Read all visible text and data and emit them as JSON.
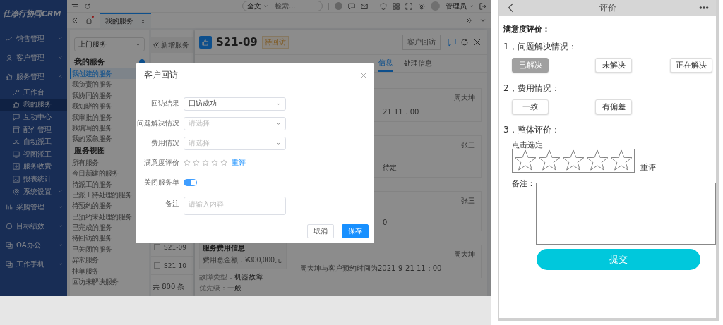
{
  "sidebar": {
    "logo": "仕净行协同CRM",
    "items": [
      {
        "label": "销售管理",
        "selected": false,
        "expanded": false
      },
      {
        "label": "客户管理",
        "selected": false,
        "expanded": false
      },
      {
        "label": "服务管理",
        "selected": false,
        "expanded": true,
        "children": [
          {
            "label": "工作台",
            "selected": false
          },
          {
            "label": "我的服务",
            "selected": true
          },
          {
            "label": "互动中心",
            "selected": false
          },
          {
            "label": "配件管理",
            "selected": false
          },
          {
            "label": "自动派工",
            "selected": false
          },
          {
            "label": "视图派工",
            "selected": false
          },
          {
            "label": "服务收费",
            "selected": false
          },
          {
            "label": "报表统计",
            "selected": false
          },
          {
            "label": "系统设置",
            "selected": false,
            "expanded": false
          }
        ]
      },
      {
        "label": "采购管理",
        "selected": false,
        "expanded": false
      },
      {
        "label": "目标绩效",
        "selected": false,
        "expanded": false
      },
      {
        "label": "OA办公",
        "selected": false,
        "expanded": false
      },
      {
        "label": "工作手机",
        "selected": false,
        "expanded": false
      }
    ]
  },
  "topbar": {
    "search_scope": "全文",
    "search_placeholder": "检索...",
    "user": "管理员"
  },
  "tabs": {
    "home_dot": true,
    "items": [
      {
        "label": "我的服务",
        "selected": true
      }
    ]
  },
  "service_select": {
    "value": "上门服务"
  },
  "menu_sections": [
    {
      "title": "我的服务",
      "items": [
        {
          "label": "我创建的服务",
          "selected": true
        },
        {
          "label": "我负责的服务",
          "selected": false
        },
        {
          "label": "我协同的服务",
          "selected": false
        },
        {
          "label": "我知晓的服务",
          "selected": false
        },
        {
          "label": "我审批的服务",
          "selected": false
        },
        {
          "label": "我填写的服务",
          "selected": false
        },
        {
          "label": "我的紧急服务",
          "selected": false
        }
      ]
    },
    {
      "title": "服务视图",
      "items": [
        {
          "label": "所有服务",
          "selected": false
        },
        {
          "label": "今日新建的服务",
          "selected": false
        },
        {
          "label": "待派工的服务",
          "selected": false
        },
        {
          "label": "已派工待处理的服务",
          "selected": false
        },
        {
          "label": "待预约的服务",
          "selected": false
        },
        {
          "label": "已预约未处理的服务",
          "selected": false
        },
        {
          "label": "已完成的服务",
          "selected": false
        },
        {
          "label": "待回访的服务",
          "selected": false
        },
        {
          "label": "已关闭的服务",
          "selected": false
        },
        {
          "label": "异常服务",
          "selected": false
        },
        {
          "label": "挂单服务",
          "selected": false
        },
        {
          "label": "回访未解决服务",
          "selected": false
        }
      ]
    }
  ],
  "list": {
    "toolbar_label": "新增服务",
    "rows": [
      {
        "id": "S21-09",
        "checked": false
      },
      {
        "id": "S21-10",
        "checked": false
      }
    ],
    "total": "共 800 条"
  },
  "detail": {
    "code": "S21-09",
    "status": "待回访",
    "action_button": "客户回访",
    "tabs": [
      {
        "label": "信息",
        "selected": true
      },
      {
        "label": "处理信息",
        "selected": false
      }
    ],
    "fee_box": {
      "title": "服务费用信息",
      "total": "费用总金额：¥300,000元"
    },
    "fields": [
      {
        "label": "故障类型：",
        "value": "机器故障"
      },
      {
        "label": "优先级：",
        "value": "一般"
      }
    ],
    "records": [
      {
        "author": "周大坤",
        "text": "21  11：00"
      },
      {
        "author": "张三",
        "text": "待定"
      },
      {
        "author": "张三",
        "text": "0"
      },
      {
        "author": "周大坤",
        "text": "周大坤与客户预约时间为2021-9-21  11：00"
      }
    ]
  },
  "dialog": {
    "title": "客户回访",
    "fields": [
      {
        "kind": "select",
        "label": "回访结果",
        "value": "回访成功"
      },
      {
        "kind": "select",
        "label": "问题解决情况",
        "placeholder": "请选择"
      },
      {
        "kind": "select",
        "label": "费用情况",
        "placeholder": "请选择"
      },
      {
        "kind": "rating",
        "label": "满意度评价",
        "stars": 0,
        "reset": "重评"
      },
      {
        "kind": "switch",
        "label": "关闭服务单",
        "on": true
      },
      {
        "kind": "textarea",
        "label": "备注",
        "placeholder": "请输入内容"
      }
    ],
    "buttons": [
      {
        "label": "取消",
        "kind": "default"
      },
      {
        "label": "保存",
        "kind": "primary"
      }
    ]
  },
  "mobile": {
    "title": "评价",
    "heading": "满意度评价：",
    "questions": [
      {
        "kind": "choice",
        "label": "1，问题解决情况：",
        "options": [
          {
            "label": "已解决",
            "selected": true
          },
          {
            "label": "未解决",
            "selected": false
          },
          {
            "label": "正在解决",
            "selected": false
          }
        ]
      },
      {
        "kind": "choice",
        "label": "2，费用情况：",
        "options": [
          {
            "label": "一致",
            "selected": false
          },
          {
            "label": "有偏差",
            "selected": false
          }
        ]
      },
      {
        "kind": "rating",
        "label": "3，整体评价：",
        "hint": "点击选定",
        "stars": 0,
        "reset": "重评"
      }
    ],
    "note_label": "备注：",
    "submit": "提交"
  }
}
